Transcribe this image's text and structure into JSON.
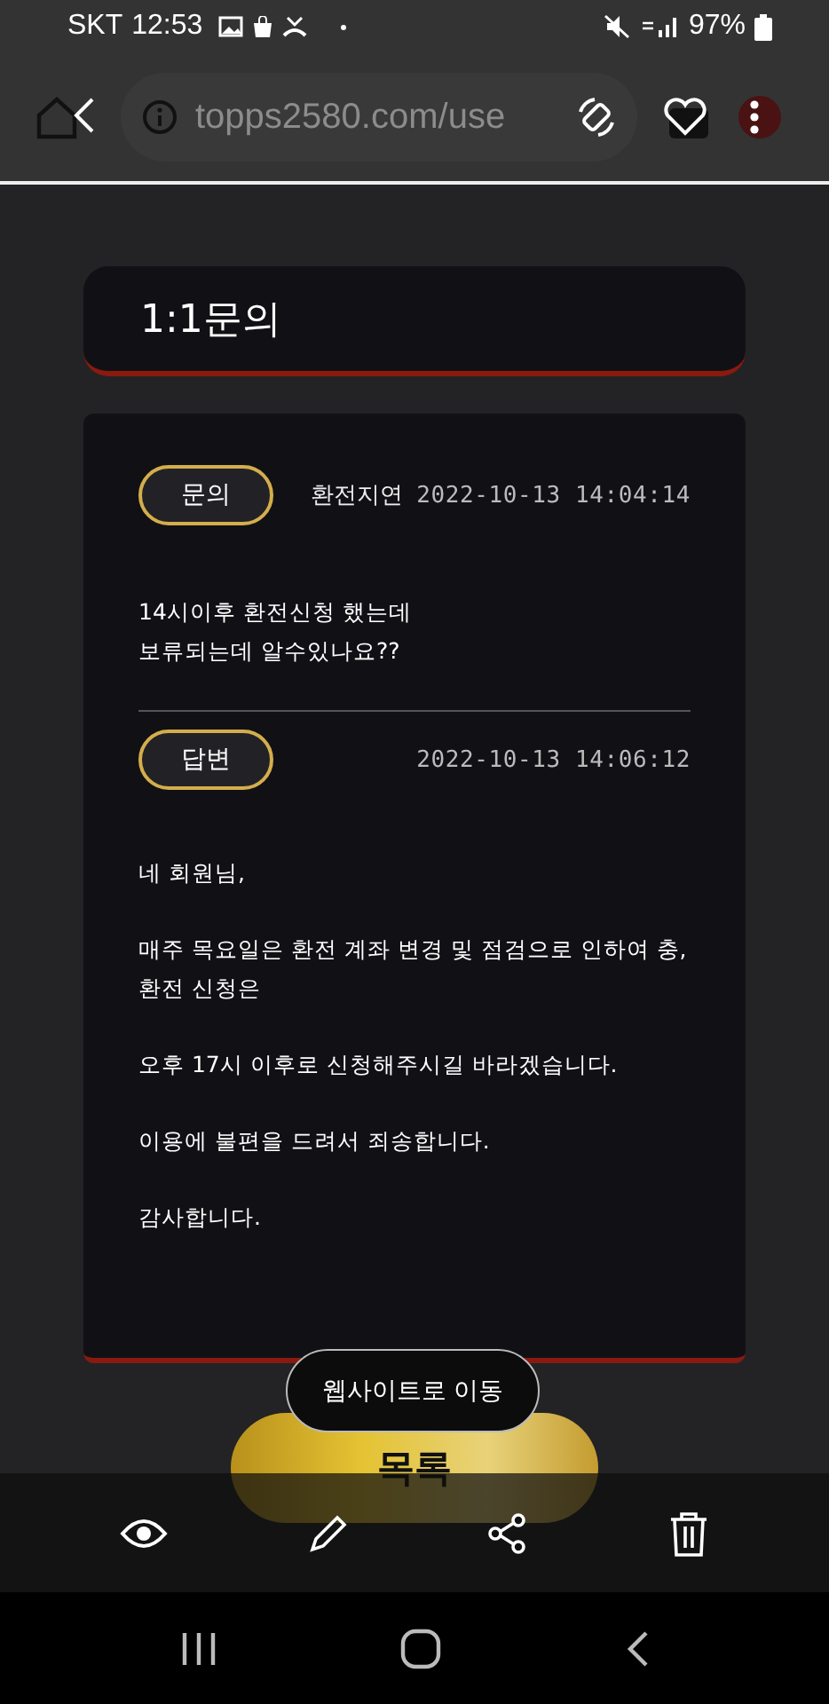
{
  "status_bar": {
    "carrier": "SKT",
    "time": "12:53",
    "battery": "97%"
  },
  "browser": {
    "url": "topps2580.com/use"
  },
  "page_title": "1:1문의",
  "question": {
    "badge": "문의",
    "subject": "환전지연",
    "datetime": "2022-10-13 14:04:14",
    "body": "14시이후 환전신청 했는데\n보류되는데 알수있나요??"
  },
  "answer": {
    "badge": "답변",
    "datetime": "2022-10-13 14:06:12",
    "paragraphs": [
      "네 회원님,",
      "매주 목요일은 환전 계좌 변경 및 점검으로 인하여 충,\n환전 신청은",
      "오후 17시 이후로 신청해주시길 바라겠습니다.",
      "이용에 불편을 드려서 죄송합니다.",
      "감사합니다."
    ]
  },
  "tooltip": "웹사이트로 이동",
  "list_button": "목록"
}
